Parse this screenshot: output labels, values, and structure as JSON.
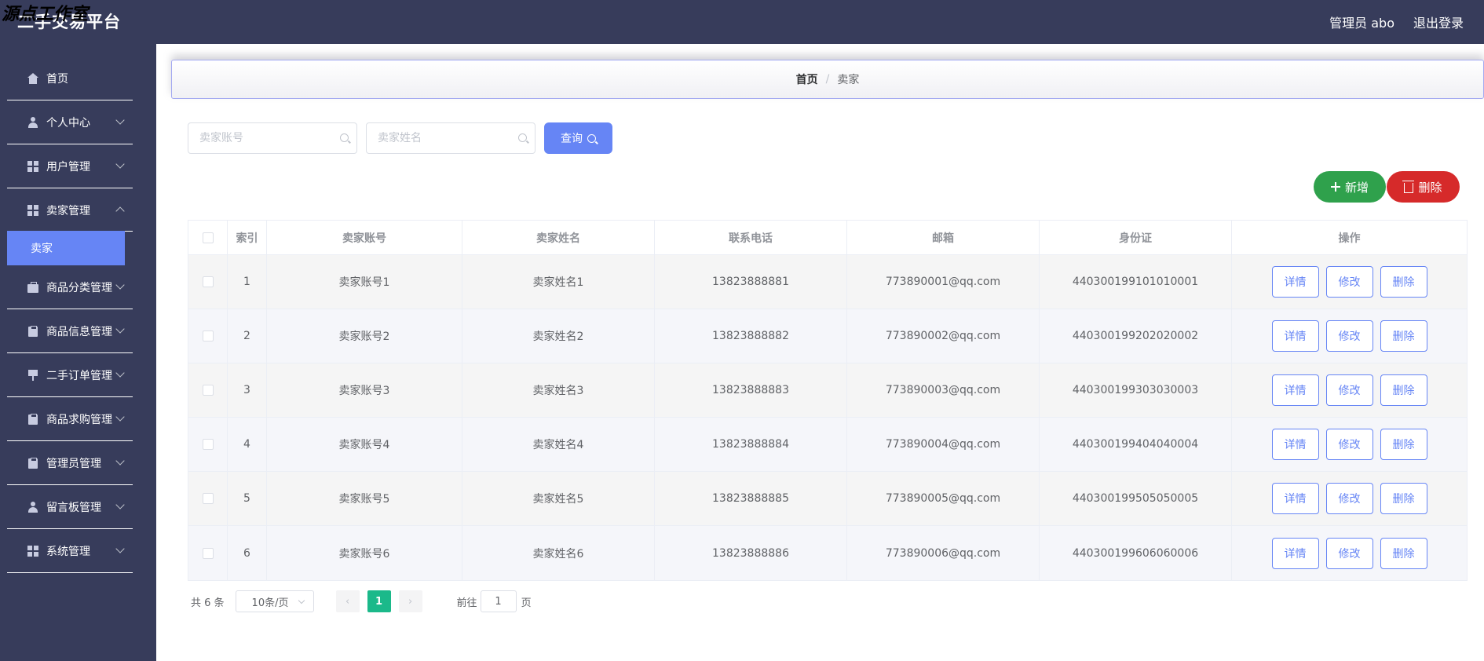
{
  "header": {
    "title": "二手交易平台",
    "watermark": "源点工作室",
    "admin_label": "管理员 abo",
    "logout_label": "退出登录"
  },
  "sidebar": {
    "items": [
      {
        "label": "首页",
        "icon": "home-icon"
      },
      {
        "label": "个人中心",
        "icon": "user-icon"
      },
      {
        "label": "用户管理",
        "icon": "grid-icon"
      },
      {
        "label": "卖家管理",
        "icon": "grid-icon"
      },
      {
        "label": "商品分类管理",
        "icon": "briefcase-icon"
      },
      {
        "label": "商品信息管理",
        "icon": "clipboard-icon"
      },
      {
        "label": "二手订单管理",
        "icon": "flag-icon"
      },
      {
        "label": "商品求购管理",
        "icon": "clipboard-icon"
      },
      {
        "label": "管理员管理",
        "icon": "clipboard-icon"
      },
      {
        "label": "留言板管理",
        "icon": "user-icon"
      },
      {
        "label": "系统管理",
        "icon": "grid-icon"
      }
    ],
    "active_sub": "卖家"
  },
  "breadcrumb": {
    "home": "首页",
    "separator": "/",
    "current": "卖家"
  },
  "search": {
    "account_placeholder": "卖家账号",
    "name_placeholder": "卖家姓名",
    "query_label": "查询"
  },
  "actions": {
    "add_label": "新增",
    "delete_label": "删除"
  },
  "table": {
    "headers": [
      "索引",
      "卖家账号",
      "卖家姓名",
      "联系电话",
      "邮箱",
      "身份证",
      "操作"
    ],
    "rows": [
      {
        "idx": "1",
        "account": "卖家账号1",
        "name": "卖家姓名1",
        "phone": "13823888881",
        "email": "773890001@qq.com",
        "id": "440300199101010001"
      },
      {
        "idx": "2",
        "account": "卖家账号2",
        "name": "卖家姓名2",
        "phone": "13823888882",
        "email": "773890002@qq.com",
        "id": "440300199202020002"
      },
      {
        "idx": "3",
        "account": "卖家账号3",
        "name": "卖家姓名3",
        "phone": "13823888883",
        "email": "773890003@qq.com",
        "id": "440300199303030003"
      },
      {
        "idx": "4",
        "account": "卖家账号4",
        "name": "卖家姓名4",
        "phone": "13823888884",
        "email": "773890004@qq.com",
        "id": "440300199404040004"
      },
      {
        "idx": "5",
        "account": "卖家账号5",
        "name": "卖家姓名5",
        "phone": "13823888885",
        "email": "773890005@qq.com",
        "id": "440300199505050005"
      },
      {
        "idx": "6",
        "account": "卖家账号6",
        "name": "卖家姓名6",
        "phone": "13823888886",
        "email": "773890006@qq.com",
        "id": "440300199606060006"
      }
    ],
    "ops": {
      "detail": "详情",
      "edit": "修改",
      "delete": "删除"
    }
  },
  "pagination": {
    "total": "共 6 条",
    "page_size": "10条/页",
    "current_page": "1",
    "goto_prefix": "前往",
    "goto_value": "1",
    "goto_suffix": "页"
  },
  "colors": {
    "sidebar_bg": "#373c5b",
    "accent": "#6685f5",
    "add": "#2fa14c",
    "delete": "#d62a2a",
    "page_active": "#1bb98a"
  }
}
